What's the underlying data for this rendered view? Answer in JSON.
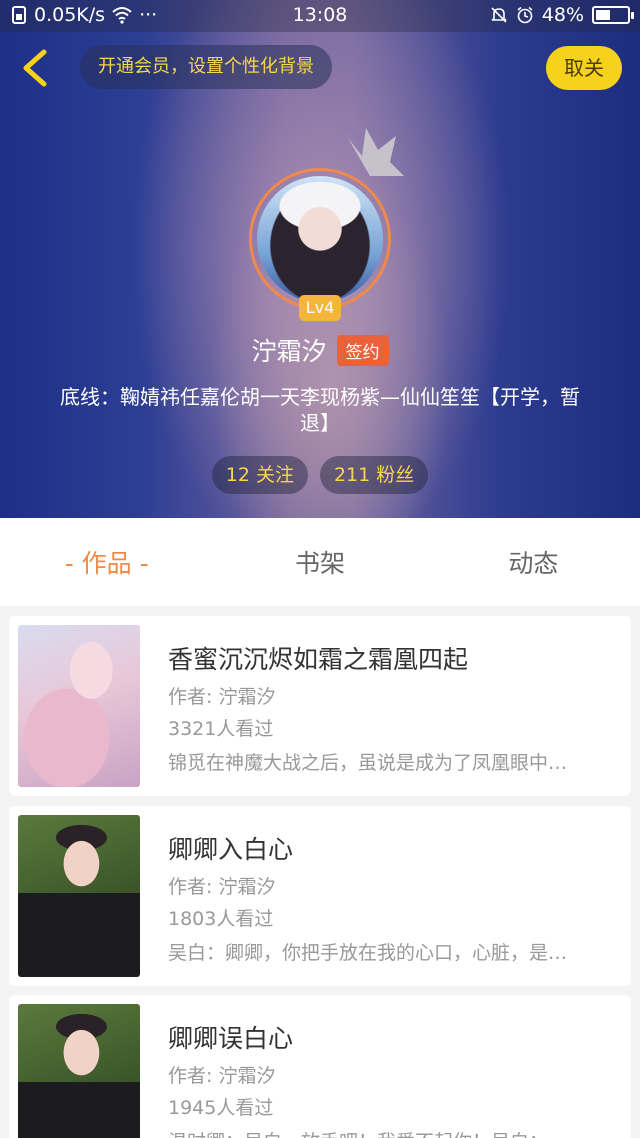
{
  "status_bar": {
    "network_speed": "0.05K/s",
    "more": "···",
    "time": "13:08",
    "battery": "48%",
    "battery_level": 0.48
  },
  "header": {
    "vip_prompt": "开通会员，设置个性化背景",
    "unfollow_label": "取关"
  },
  "profile": {
    "level": "Lv4",
    "username": "泞霜汐",
    "signed_badge": "签约",
    "bio": "底线：鞠婧祎任嘉伦胡一天李现杨紫—仙仙笙笙【开学，暂退】",
    "following": "12 关注",
    "followers": "211 粉丝"
  },
  "tabs": [
    {
      "label": "- 作品 -",
      "active": true
    },
    {
      "label": "书架",
      "active": false
    },
    {
      "label": "动态",
      "active": false
    }
  ],
  "books": [
    {
      "title": "香蜜沉沉烬如霜之霜凰四起",
      "author": "作者: 泞霜汐",
      "views": "3321人看过",
      "desc": "锦觅在神魔大战之后，虽说是成为了凤凰眼中…"
    },
    {
      "title": "卿卿入白心",
      "author": "作者: 泞霜汐",
      "views": "1803人看过",
      "desc": "吴白：卿卿，你把手放在我的心口，心脏，是…"
    },
    {
      "title": "卿卿误白心",
      "author": "作者: 泞霜汐",
      "views": "1945人看过",
      "desc": "温时卿：吴白，放手吧！我爱不起你！吴白：…"
    }
  ],
  "colors": {
    "accent_orange": "#f08a4b",
    "accent_yellow": "#f7d21a",
    "signed_badge": "#e8623a",
    "level_badge": "#f4b63a"
  },
  "icons": {
    "back": "chevron-left-icon",
    "crown": "crown-icon",
    "wifi": "wifi-icon",
    "alarm": "alarm-icon",
    "mute": "bell-off-icon"
  }
}
